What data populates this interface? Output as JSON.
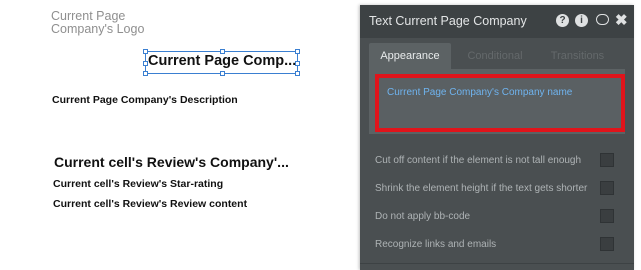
{
  "canvas": {
    "logo_placeholder": "Current Page Company's Logo",
    "selected_text": "Current Page Comp...",
    "description": "Current Page Company's Description",
    "review_company": "Current cell's Review's Company'...",
    "review_star_rating": "Current cell's Review's Star-rating",
    "review_content": "Current cell's Review's Review content"
  },
  "panel": {
    "title": "Text Current Page Company",
    "header_icons": [
      "question-icon",
      "info-icon",
      "comment-icon",
      "close-icon"
    ],
    "help_glyph": "?",
    "info_glyph": "i",
    "close_glyph": "✖",
    "tabs": [
      {
        "label": "Appearance",
        "active": true
      },
      {
        "label": "Conditional",
        "active": false
      },
      {
        "label": "Transitions",
        "active": false
      }
    ],
    "dynamic_text": "Current Page Company's Company name",
    "small_text": "",
    "options": [
      {
        "label": "Cut off content if the element is not tall enough",
        "checked": false
      },
      {
        "label": "Shrink the element height if the text gets shorter",
        "checked": false
      },
      {
        "label": "Do not apply bb-code",
        "checked": false
      },
      {
        "label": "Recognize links and emails",
        "checked": false
      }
    ]
  },
  "colors": {
    "selection": "#3a7fd1",
    "highlight_box": "#e0141b",
    "dynamic_expression": "#6fb3ee",
    "panel_bg": "#4a4f51"
  }
}
